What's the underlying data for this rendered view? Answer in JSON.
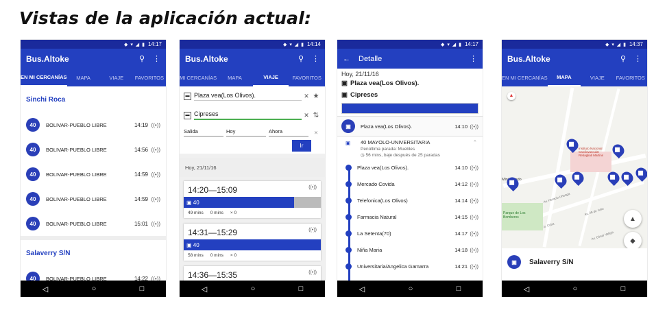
{
  "title": "Vistas de la aplicación actual:",
  "status_icons": "◆ ▾ ◢ ▮",
  "colors": {
    "primary": "#2340c0",
    "status": "#1a2a9c"
  },
  "icons": {
    "search": "search-icon",
    "more": "more-vert-icon",
    "back": "back-arrow-icon",
    "bus": "bus-icon",
    "signal": "signal-icon"
  },
  "nav": {
    "back": "◁",
    "home": "○",
    "recent": "□"
  },
  "phone1": {
    "time": "14:17",
    "app_title": "Bus.Altoke",
    "tabs": [
      "EN MI CERCANÍAS",
      "MAPA",
      "VIAJE",
      "FAVORITOS"
    ],
    "stop1": "Sinchi Roca",
    "rows1": [
      {
        "route": "40",
        "name": "BOLIVAR-PUEBLO LIBRE",
        "time": "14:19"
      },
      {
        "route": "40",
        "name": "BOLIVAR-PUEBLO LIBRE",
        "time": "14:56"
      },
      {
        "route": "40",
        "name": "BOLIVAR-PUEBLO LIBRE",
        "time": "14:59"
      },
      {
        "route": "40",
        "name": "BOLIVAR-PUEBLO LIBRE",
        "time": "14:59"
      },
      {
        "route": "40",
        "name": "BOLIVAR-PUEBLO LIBRE",
        "time": "15:01"
      }
    ],
    "stop2": "Salaverry S/N",
    "rows2": [
      {
        "route": "40",
        "name": "BOLIVAR-PUEBLO LIBRE",
        "time": "14:22"
      }
    ]
  },
  "phone2": {
    "time": "14:14",
    "app_title": "Bus.Altoke",
    "tabs": [
      "MI CERCANÍAS",
      "MAPA",
      "VIAJE",
      "FAVORITOS"
    ],
    "origin": "Plaza vea(Los Olivos).",
    "destination": "Cipreses",
    "selects": [
      "Salida",
      "Hoy",
      "Ahora"
    ],
    "go_button": "Ir",
    "day": "Hoy, 21/11/16",
    "trips": [
      {
        "range": "14:20—15:09",
        "route": "40",
        "mins": "49 mins",
        "walk": "0 mins",
        "transfers": "× 0"
      },
      {
        "range": "14:31—15:29",
        "route": "40",
        "mins": "58 mins",
        "walk": "0 mins",
        "transfers": "× 0"
      },
      {
        "range": "14:36—15:35"
      }
    ]
  },
  "phone3": {
    "time": "14:17",
    "app_title": "Detalle",
    "date": "Hoy, 21/11/16",
    "from": "Plaza vea(Los Olivos).",
    "to": "Cipreses",
    "board_stop": "Plaza vea(Los Olivos).",
    "board_time": "14:10",
    "route_name": "40 MAYOLO-UNIVERSITARIA",
    "penultimate": "Penúltima parada: Muebles",
    "duration": "◷ 56 mins, baje después de 25 paradas",
    "stops": [
      {
        "name": "Plaza vea(Los Olivos).",
        "time": "14:10"
      },
      {
        "name": "Mercado Covida",
        "time": "14:12"
      },
      {
        "name": "Telefonica(Los Olivos)",
        "time": "14:14"
      },
      {
        "name": "Farmacia Natural",
        "time": "14:15"
      },
      {
        "name": "La Setenta(70)",
        "time": "14:17"
      },
      {
        "name": "Niña Maria",
        "time": "14:18"
      },
      {
        "name": "Universitaria/Angelica Gamarra",
        "time": "14:21"
      }
    ]
  },
  "phone4": {
    "time": "14:37",
    "app_title": "Bus.Altoke",
    "tabs": [
      "EN MI CERCANÍAS",
      "MAPA",
      "VIAJE",
      "FAVORITOS"
    ],
    "map_labels": [
      "Instituto Nacional Cardiovascular Rebagliati Martins",
      "Mini-Mundo",
      "Parque de Los Bomberos",
      "Av. Horacio Urteaga",
      "Jr. Cuba",
      "Av. 28 de Julio",
      "Av. César Vallejo"
    ],
    "selected_stop": "Salaverry S/N"
  }
}
